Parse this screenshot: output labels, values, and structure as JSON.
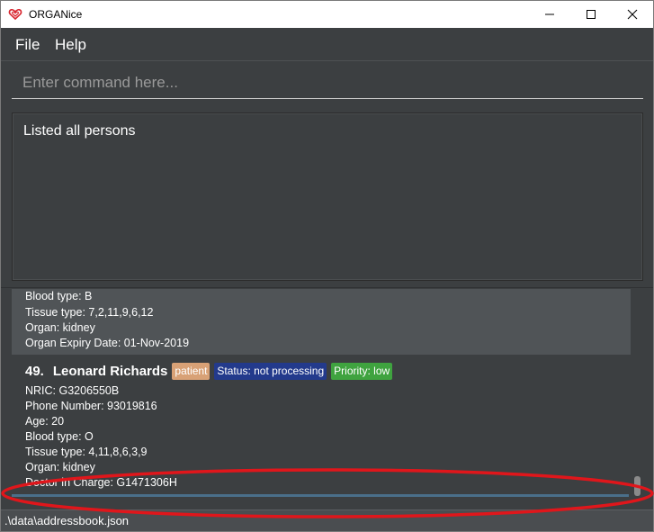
{
  "window": {
    "title": "ORGANice",
    "icon": "heart-icon",
    "controls": [
      "minimize-icon",
      "maximize-icon",
      "close-icon"
    ]
  },
  "menu": {
    "items": [
      {
        "label": "File"
      },
      {
        "label": "Help"
      }
    ]
  },
  "command": {
    "placeholder": "Enter command here...",
    "value": ""
  },
  "result": {
    "message": "Listed all persons"
  },
  "person_list": {
    "previous_card": {
      "fields": [
        "Blood type: B",
        "Tissue type: 7,2,11,9,6,12",
        "Organ: kidney",
        "Organ Expiry Date: 01-Nov-2019"
      ]
    },
    "current_card": {
      "index": "49.",
      "name": "Leonard Richards",
      "tags": [
        {
          "text": "patient",
          "color": "#d8a176"
        },
        {
          "text": "Status: not processing",
          "color": "#233a8c"
        },
        {
          "text": "Priority: low",
          "color": "#3fa33f"
        }
      ],
      "fields": [
        "NRIC: G3206550B",
        "Phone Number: 93019816",
        "Age: 20",
        "Blood type: O",
        "Tissue type: 4,11,8,6,3,9",
        "Organ: kidney",
        "Doctor in Charge: G1471306H"
      ]
    }
  },
  "status_bar": {
    "path": ".\\data\\addressbook.json"
  },
  "colors": {
    "background": "#3c3f41",
    "selected_card": "#505457",
    "annotation": "#e0161b"
  }
}
